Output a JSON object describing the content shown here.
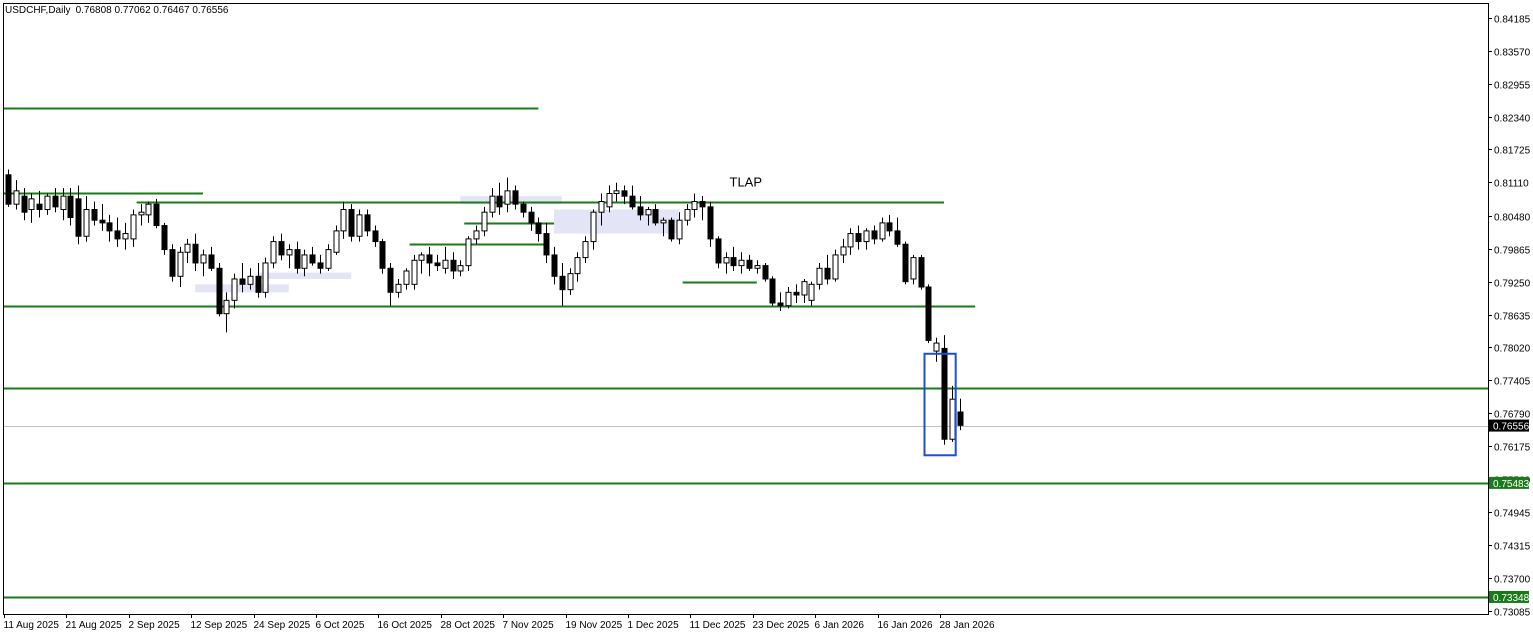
{
  "header": {
    "symbol": "USDCHF,Daily",
    "ohlc": "0.76808 0.77062 0.76467 0.76556"
  },
  "colors": {
    "background": "#ffffff",
    "frame": "#000000",
    "level_line": "#1a7a1a",
    "zone_fill": "#e3e5f6",
    "highlight_box": "#1f4fd1",
    "bull_candle": "#ffffff",
    "bear_candle": "#000000",
    "current_price_line": "#c0c0c0",
    "price_tag_bg": "#1a7a1a",
    "price_tag_text": "#ffffff"
  },
  "chart_data": {
    "type": "candlestick",
    "symbol": "USDCHF",
    "timeframe": "Daily",
    "ylim": [
      0.73,
      0.845
    ],
    "y_ticks": [
      "0.84185",
      "0.83570",
      "0.82955",
      "0.82340",
      "0.81725",
      "0.81110",
      "0.80480",
      "0.79865",
      "0.79250",
      "0.78635",
      "0.78020",
      "0.77405",
      "0.76790",
      "0.76175",
      "0.75560",
      "0.74945",
      "0.74315",
      "0.73700",
      "0.73085"
    ],
    "x_tick_labels": [
      "11 Aug 2025",
      "21 Aug 2025",
      "2 Sep 2025",
      "12 Sep 2025",
      "24 Sep 2025",
      "6 Oct 2025",
      "16 Oct 2025",
      "28 Oct 2025",
      "7 Nov 2025",
      "19 Nov 2025",
      "1 Dec 2025",
      "11 Dec 2025",
      "23 Dec 2025",
      "6 Jan 2026",
      "16 Jan 2026",
      "28 Jan 2026"
    ],
    "x_tick_bar_index": [
      0,
      8,
      16,
      24,
      32,
      40,
      48,
      56,
      64,
      72,
      80,
      88,
      96,
      104,
      112,
      120
    ],
    "current_price": "0.76556",
    "price_tags": [
      "0.75483",
      "0.73348"
    ],
    "candles": [
      {
        "o": 0.8125,
        "h": 0.8135,
        "l": 0.8065,
        "c": 0.807
      },
      {
        "o": 0.807,
        "h": 0.8115,
        "l": 0.806,
        "c": 0.8095
      },
      {
        "o": 0.8085,
        "h": 0.81,
        "l": 0.804,
        "c": 0.8055
      },
      {
        "o": 0.806,
        "h": 0.809,
        "l": 0.8035,
        "c": 0.808
      },
      {
        "o": 0.807,
        "h": 0.8095,
        "l": 0.8045,
        "c": 0.806
      },
      {
        "o": 0.806,
        "h": 0.809,
        "l": 0.805,
        "c": 0.8085
      },
      {
        "o": 0.8085,
        "h": 0.81,
        "l": 0.8055,
        "c": 0.8065
      },
      {
        "o": 0.806,
        "h": 0.81,
        "l": 0.804,
        "c": 0.8085
      },
      {
        "o": 0.8085,
        "h": 0.81,
        "l": 0.803,
        "c": 0.8045
      },
      {
        "o": 0.808,
        "h": 0.8105,
        "l": 0.7995,
        "c": 0.801
      },
      {
        "o": 0.801,
        "h": 0.8085,
        "l": 0.8,
        "c": 0.806
      },
      {
        "o": 0.806,
        "h": 0.8075,
        "l": 0.803,
        "c": 0.804
      },
      {
        "o": 0.804,
        "h": 0.807,
        "l": 0.802,
        "c": 0.8035
      },
      {
        "o": 0.8035,
        "h": 0.805,
        "l": 0.8,
        "c": 0.802
      },
      {
        "o": 0.802,
        "h": 0.8045,
        "l": 0.799,
        "c": 0.8005
      },
      {
        "o": 0.8005,
        "h": 0.8035,
        "l": 0.7985,
        "c": 0.8015
      },
      {
        "o": 0.8005,
        "h": 0.806,
        "l": 0.799,
        "c": 0.805
      },
      {
        "o": 0.805,
        "h": 0.807,
        "l": 0.803,
        "c": 0.8055
      },
      {
        "o": 0.805,
        "h": 0.8075,
        "l": 0.8035,
        "c": 0.807
      },
      {
        "o": 0.807,
        "h": 0.808,
        "l": 0.8025,
        "c": 0.803
      },
      {
        "o": 0.803,
        "h": 0.8035,
        "l": 0.7975,
        "c": 0.7985
      },
      {
        "o": 0.7985,
        "h": 0.7995,
        "l": 0.7925,
        "c": 0.7935
      },
      {
        "o": 0.7935,
        "h": 0.799,
        "l": 0.7915,
        "c": 0.798
      },
      {
        "o": 0.798,
        "h": 0.8005,
        "l": 0.796,
        "c": 0.7995
      },
      {
        "o": 0.7995,
        "h": 0.8015,
        "l": 0.7945,
        "c": 0.796
      },
      {
        "o": 0.796,
        "h": 0.7985,
        "l": 0.7935,
        "c": 0.7975
      },
      {
        "o": 0.7975,
        "h": 0.799,
        "l": 0.7945,
        "c": 0.795
      },
      {
        "o": 0.795,
        "h": 0.796,
        "l": 0.786,
        "c": 0.7865
      },
      {
        "o": 0.7865,
        "h": 0.7905,
        "l": 0.783,
        "c": 0.789
      },
      {
        "o": 0.789,
        "h": 0.794,
        "l": 0.7875,
        "c": 0.793
      },
      {
        "o": 0.793,
        "h": 0.796,
        "l": 0.7905,
        "c": 0.792
      },
      {
        "o": 0.792,
        "h": 0.795,
        "l": 0.791,
        "c": 0.7935
      },
      {
        "o": 0.7935,
        "h": 0.796,
        "l": 0.7895,
        "c": 0.7905
      },
      {
        "o": 0.7905,
        "h": 0.797,
        "l": 0.7895,
        "c": 0.796
      },
      {
        "o": 0.796,
        "h": 0.801,
        "l": 0.795,
        "c": 0.8
      },
      {
        "o": 0.8,
        "h": 0.8015,
        "l": 0.7965,
        "c": 0.7975
      },
      {
        "o": 0.7975,
        "h": 0.7995,
        "l": 0.795,
        "c": 0.7985
      },
      {
        "o": 0.7985,
        "h": 0.8,
        "l": 0.794,
        "c": 0.795
      },
      {
        "o": 0.795,
        "h": 0.7985,
        "l": 0.7935,
        "c": 0.7975
      },
      {
        "o": 0.7975,
        "h": 0.799,
        "l": 0.7955,
        "c": 0.796
      },
      {
        "o": 0.796,
        "h": 0.7975,
        "l": 0.794,
        "c": 0.795
      },
      {
        "o": 0.795,
        "h": 0.7995,
        "l": 0.7945,
        "c": 0.7985
      },
      {
        "o": 0.798,
        "h": 0.803,
        "l": 0.7975,
        "c": 0.802
      },
      {
        "o": 0.802,
        "h": 0.8075,
        "l": 0.8005,
        "c": 0.806
      },
      {
        "o": 0.806,
        "h": 0.807,
        "l": 0.8,
        "c": 0.801
      },
      {
        "o": 0.801,
        "h": 0.806,
        "l": 0.8,
        "c": 0.805
      },
      {
        "o": 0.805,
        "h": 0.806,
        "l": 0.801,
        "c": 0.802
      },
      {
        "o": 0.802,
        "h": 0.803,
        "l": 0.799,
        "c": 0.8
      },
      {
        "o": 0.8,
        "h": 0.8005,
        "l": 0.794,
        "c": 0.795
      },
      {
        "o": 0.795,
        "h": 0.796,
        "l": 0.788,
        "c": 0.7905
      },
      {
        "o": 0.7905,
        "h": 0.793,
        "l": 0.7895,
        "c": 0.792
      },
      {
        "o": 0.792,
        "h": 0.795,
        "l": 0.791,
        "c": 0.7945
      },
      {
        "o": 0.792,
        "h": 0.7975,
        "l": 0.791,
        "c": 0.7965
      },
      {
        "o": 0.7965,
        "h": 0.798,
        "l": 0.794,
        "c": 0.7975
      },
      {
        "o": 0.7975,
        "h": 0.799,
        "l": 0.7935,
        "c": 0.796
      },
      {
        "o": 0.796,
        "h": 0.7975,
        "l": 0.7945,
        "c": 0.7955
      },
      {
        "o": 0.795,
        "h": 0.799,
        "l": 0.794,
        "c": 0.7965
      },
      {
        "o": 0.7965,
        "h": 0.798,
        "l": 0.793,
        "c": 0.7945
      },
      {
        "o": 0.7945,
        "h": 0.7965,
        "l": 0.7935,
        "c": 0.7955
      },
      {
        "o": 0.7955,
        "h": 0.801,
        "l": 0.7945,
        "c": 0.8005
      },
      {
        "o": 0.8005,
        "h": 0.803,
        "l": 0.7995,
        "c": 0.802
      },
      {
        "o": 0.802,
        "h": 0.8065,
        "l": 0.801,
        "c": 0.8055
      },
      {
        "o": 0.8055,
        "h": 0.81,
        "l": 0.8045,
        "c": 0.8085
      },
      {
        "o": 0.8085,
        "h": 0.811,
        "l": 0.805,
        "c": 0.8065
      },
      {
        "o": 0.807,
        "h": 0.812,
        "l": 0.8055,
        "c": 0.8095
      },
      {
        "o": 0.8095,
        "h": 0.8105,
        "l": 0.806,
        "c": 0.807
      },
      {
        "o": 0.807,
        "h": 0.8075,
        "l": 0.8045,
        "c": 0.8055
      },
      {
        "o": 0.8055,
        "h": 0.8065,
        "l": 0.802,
        "c": 0.8035
      },
      {
        "o": 0.8035,
        "h": 0.8045,
        "l": 0.8,
        "c": 0.8015
      },
      {
        "o": 0.8015,
        "h": 0.8035,
        "l": 0.796,
        "c": 0.7975
      },
      {
        "o": 0.7975,
        "h": 0.799,
        "l": 0.792,
        "c": 0.7935
      },
      {
        "o": 0.7935,
        "h": 0.796,
        "l": 0.788,
        "c": 0.791
      },
      {
        "o": 0.791,
        "h": 0.795,
        "l": 0.79,
        "c": 0.794
      },
      {
        "o": 0.794,
        "h": 0.798,
        "l": 0.7925,
        "c": 0.797
      },
      {
        "o": 0.797,
        "h": 0.801,
        "l": 0.796,
        "c": 0.8
      },
      {
        "o": 0.8,
        "h": 0.806,
        "l": 0.7985,
        "c": 0.8055
      },
      {
        "o": 0.8055,
        "h": 0.809,
        "l": 0.803,
        "c": 0.8075
      },
      {
        "o": 0.8065,
        "h": 0.8105,
        "l": 0.8055,
        "c": 0.809
      },
      {
        "o": 0.809,
        "h": 0.811,
        "l": 0.8075,
        "c": 0.8095
      },
      {
        "o": 0.8095,
        "h": 0.8105,
        "l": 0.807,
        "c": 0.8085
      },
      {
        "o": 0.8085,
        "h": 0.8105,
        "l": 0.806,
        "c": 0.8065
      },
      {
        "o": 0.8065,
        "h": 0.8085,
        "l": 0.804,
        "c": 0.805
      },
      {
        "o": 0.805,
        "h": 0.8065,
        "l": 0.803,
        "c": 0.806
      },
      {
        "o": 0.806,
        "h": 0.807,
        "l": 0.803,
        "c": 0.8035
      },
      {
        "o": 0.8035,
        "h": 0.8045,
        "l": 0.801,
        "c": 0.804
      },
      {
        "o": 0.804,
        "h": 0.8045,
        "l": 0.8,
        "c": 0.8005
      },
      {
        "o": 0.8005,
        "h": 0.8055,
        "l": 0.7995,
        "c": 0.804
      },
      {
        "o": 0.804,
        "h": 0.807,
        "l": 0.803,
        "c": 0.806
      },
      {
        "o": 0.806,
        "h": 0.809,
        "l": 0.8045,
        "c": 0.8075
      },
      {
        "o": 0.8075,
        "h": 0.8085,
        "l": 0.804,
        "c": 0.8065
      },
      {
        "o": 0.8065,
        "h": 0.8075,
        "l": 0.799,
        "c": 0.8005
      },
      {
        "o": 0.8005,
        "h": 0.801,
        "l": 0.795,
        "c": 0.796
      },
      {
        "o": 0.796,
        "h": 0.798,
        "l": 0.794,
        "c": 0.797
      },
      {
        "o": 0.797,
        "h": 0.799,
        "l": 0.7945,
        "c": 0.7955
      },
      {
        "o": 0.7955,
        "h": 0.798,
        "l": 0.794,
        "c": 0.7965
      },
      {
        "o": 0.7965,
        "h": 0.7975,
        "l": 0.7945,
        "c": 0.795
      },
      {
        "o": 0.795,
        "h": 0.7965,
        "l": 0.794,
        "c": 0.7955
      },
      {
        "o": 0.7955,
        "h": 0.796,
        "l": 0.7925,
        "c": 0.793
      },
      {
        "o": 0.793,
        "h": 0.7935,
        "l": 0.788,
        "c": 0.7885
      },
      {
        "o": 0.7885,
        "h": 0.7905,
        "l": 0.787,
        "c": 0.788
      },
      {
        "o": 0.788,
        "h": 0.7915,
        "l": 0.7875,
        "c": 0.7905
      },
      {
        "o": 0.7905,
        "h": 0.792,
        "l": 0.7885,
        "c": 0.79
      },
      {
        "o": 0.79,
        "h": 0.793,
        "l": 0.7885,
        "c": 0.7925
      },
      {
        "o": 0.789,
        "h": 0.7925,
        "l": 0.788,
        "c": 0.792
      },
      {
        "o": 0.792,
        "h": 0.796,
        "l": 0.791,
        "c": 0.795
      },
      {
        "o": 0.795,
        "h": 0.7975,
        "l": 0.792,
        "c": 0.793
      },
      {
        "o": 0.793,
        "h": 0.7985,
        "l": 0.7925,
        "c": 0.7975
      },
      {
        "o": 0.7975,
        "h": 0.8005,
        "l": 0.796,
        "c": 0.799
      },
      {
        "o": 0.799,
        "h": 0.8025,
        "l": 0.7975,
        "c": 0.8015
      },
      {
        "o": 0.8015,
        "h": 0.803,
        "l": 0.7985,
        "c": 0.8
      },
      {
        "o": 0.8,
        "h": 0.8025,
        "l": 0.7985,
        "c": 0.802
      },
      {
        "o": 0.802,
        "h": 0.803,
        "l": 0.7995,
        "c": 0.8005
      },
      {
        "o": 0.8005,
        "h": 0.8045,
        "l": 0.8,
        "c": 0.8035
      },
      {
        "o": 0.8035,
        "h": 0.805,
        "l": 0.801,
        "c": 0.802
      },
      {
        "o": 0.802,
        "h": 0.8045,
        "l": 0.799,
        "c": 0.7995
      },
      {
        "o": 0.7995,
        "h": 0.8,
        "l": 0.792,
        "c": 0.7925
      },
      {
        "o": 0.793,
        "h": 0.7975,
        "l": 0.792,
        "c": 0.797
      },
      {
        "o": 0.797,
        "h": 0.7975,
        "l": 0.791,
        "c": 0.7915
      },
      {
        "o": 0.7915,
        "h": 0.792,
        "l": 0.781,
        "c": 0.7815
      },
      {
        "o": 0.7795,
        "h": 0.782,
        "l": 0.7775,
        "c": 0.781
      },
      {
        "o": 0.78,
        "h": 0.7825,
        "l": 0.762,
        "c": 0.763
      },
      {
        "o": 0.763,
        "h": 0.773,
        "l": 0.7625,
        "c": 0.7705
      },
      {
        "o": 0.7681,
        "h": 0.7706,
        "l": 0.7647,
        "c": 0.7656
      }
    ],
    "levels": [
      {
        "price": 0.825,
        "from": 0,
        "to": 68
      },
      {
        "price": 0.809,
        "from": 0,
        "to": 25
      },
      {
        "price": 0.8075,
        "from": 17,
        "to": 120
      },
      {
        "price": 0.8035,
        "from": 59,
        "to": 70
      },
      {
        "price": 0.7995,
        "from": 52,
        "to": 69
      },
      {
        "price": 0.7925,
        "from": 87,
        "to": 96
      },
      {
        "price": 0.788,
        "from": 0,
        "to": 124
      },
      {
        "price": 0.7725,
        "from": 0,
        "to": 200
      },
      {
        "price": 0.75483,
        "from": 0,
        "to": 200
      },
      {
        "price": 0.73348,
        "from": 0,
        "to": 200
      }
    ],
    "zones": [
      {
        "from": 24,
        "to": 36,
        "top": 0.792,
        "bottom": 0.7905
      },
      {
        "from": 32,
        "to": 44,
        "top": 0.7942,
        "bottom": 0.793
      },
      {
        "from": 58,
        "to": 71,
        "top": 0.8085,
        "bottom": 0.807
      },
      {
        "from": 70,
        "to": 86,
        "top": 0.806,
        "bottom": 0.8015
      }
    ],
    "highlight": {
      "from": 117.5,
      "to": 121.5,
      "top": 0.779,
      "bottom": 0.76
    },
    "annotations": [
      {
        "text": "TLAP",
        "bar": 92.5,
        "price": 0.8103
      }
    ]
  }
}
